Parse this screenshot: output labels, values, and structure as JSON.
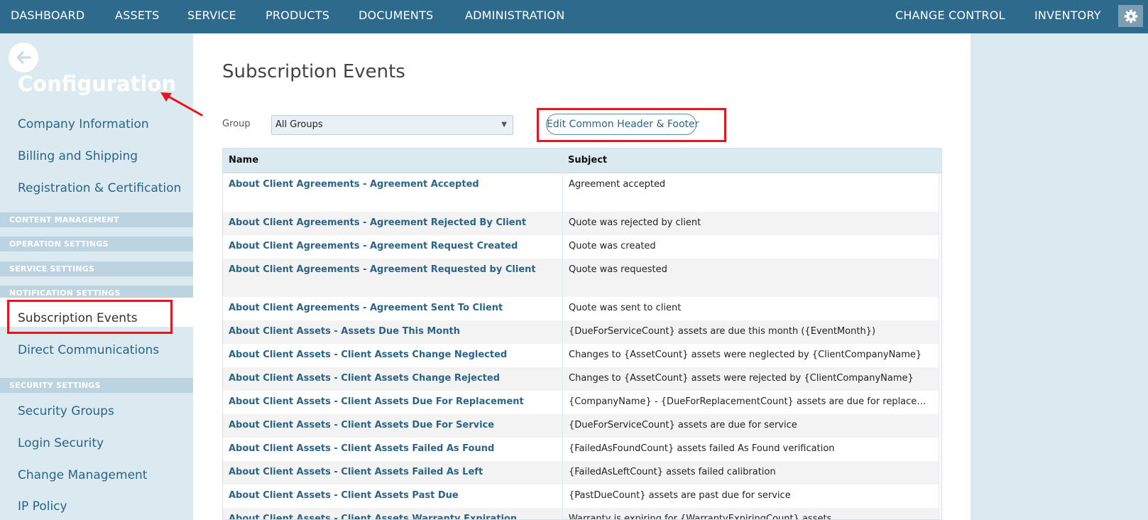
{
  "topnav": {
    "items": [
      "DASHBOARD",
      "ASSETS",
      "SERVICE",
      "PRODUCTS",
      "DOCUMENTS",
      "ADMINISTRATION"
    ],
    "right_items": [
      "CHANGE CONTROL",
      "INVENTORY"
    ],
    "settings_icon": "gear-icon"
  },
  "sidebar": {
    "back_icon": "arrow-left-icon",
    "title": "Configuration",
    "links_top": [
      "Company Information",
      "Billing and Shipping",
      "Registration & Certification"
    ],
    "sections": [
      "CONTENT MANAGEMENT",
      "OPERATION SETTINGS",
      "SERVICE SETTINGS",
      "NOTIFICATION SETTINGS"
    ],
    "active_link": "Subscription Events",
    "links_notification": [
      "Direct Communications"
    ],
    "security_section": "SECURITY SETTINGS",
    "links_security": [
      "Security Groups",
      "Login Security",
      "Change Management",
      "IP Policy"
    ]
  },
  "main": {
    "title": "Subscription Events",
    "group_label": "Group",
    "group_value": "All Groups",
    "edit_button": "Edit Common Header & Footer",
    "table": {
      "headers": [
        "Name",
        "Subject"
      ],
      "rows": [
        {
          "name": "About Client Agreements - Agreement Accepted",
          "subject": "Agreement accepted"
        },
        {
          "name": "About Client Agreements - Agreement Rejected By Client",
          "subject": "Quote was rejected by client"
        },
        {
          "name": "About Client Agreements - Agreement Request Created",
          "subject": "Quote was created"
        },
        {
          "name": "About Client Agreements - Agreement Requested by Client",
          "subject": "Quote was requested"
        },
        {
          "name": "About Client Agreements - Agreement Sent To Client",
          "subject": "Quote was sent to client"
        },
        {
          "name": "About Client Assets - Assets Due This Month",
          "subject": "{DueForServiceCount} assets are due this month ({EventMonth})"
        },
        {
          "name": "About Client Assets - Client Assets Change Neglected",
          "subject": "Changes to {AssetCount} assets were neglected by {ClientCompanyName}"
        },
        {
          "name": "About Client Assets - Client Assets Change Rejected",
          "subject": "Changes to {AssetCount} assets were rejected by {ClientCompanyName}"
        },
        {
          "name": "About Client Assets - Client Assets Due For Replacement",
          "subject": "{CompanyName} - {DueForReplacementCount} assets are due for replacement in {EventMonth}"
        },
        {
          "name": "About Client Assets - Client Assets Due For Service",
          "subject": "{DueForServiceCount} assets are due for service"
        },
        {
          "name": "About Client Assets - Client Assets Failed As Found",
          "subject": "{FailedAsFoundCount} assets failed As Found verification"
        },
        {
          "name": "About Client Assets - Client Assets Failed As Left",
          "subject": "{FailedAsLeftCount} assets failed calibration"
        },
        {
          "name": "About Client Assets - Client Assets Past Due",
          "subject": "{PastDueCount} assets are past due for service"
        },
        {
          "name": "About Client Assets - Client Assets Warranty Expiration",
          "subject": "Warranty is expiring for {WarrantyExpiringCount} assets"
        }
      ]
    }
  },
  "colors": {
    "nav_bg": "#2e6a8c",
    "sidebar_bg": "#dbeaf1",
    "section_bg": "#bcd4df",
    "link": "#2b6487",
    "highlight": "#e8141c"
  }
}
